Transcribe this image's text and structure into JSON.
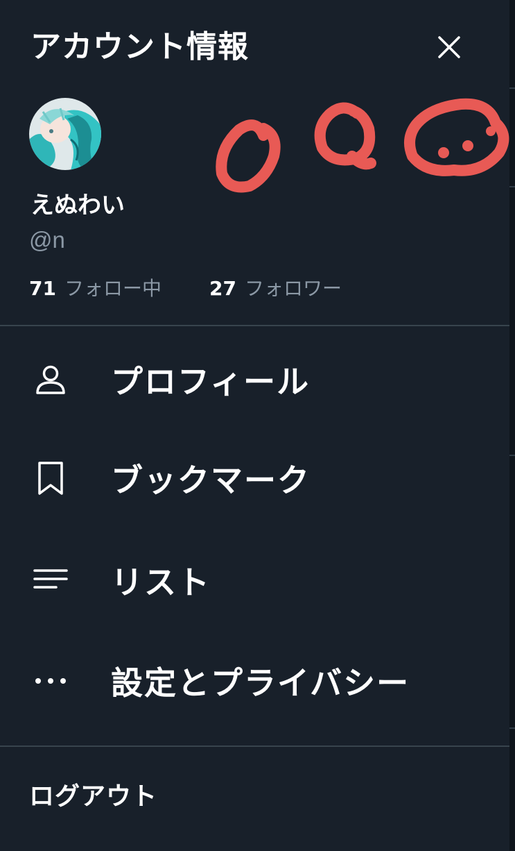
{
  "header": {
    "title": "アカウント情報",
    "close_icon": "close-icon"
  },
  "profile": {
    "display_name": "えぬわい",
    "handle": "@n",
    "following_count": "71",
    "following_label": "フォロー中",
    "followers_count": "27",
    "followers_label": "フォロワー"
  },
  "menu": {
    "items": [
      {
        "label": "プロフィール",
        "icon": "person-icon"
      },
      {
        "label": "ブックマーク",
        "icon": "bookmark-icon"
      },
      {
        "label": "リスト",
        "icon": "list-icon"
      },
      {
        "label": "設定とプライバシー",
        "icon": "more-dots-icon"
      }
    ],
    "logout_label": "ログアウト"
  },
  "colors": {
    "background": "#18202a",
    "text": "#ffffff",
    "muted": "#8b98a5",
    "divider": "#38444d",
    "annotation": "#e85a55"
  }
}
